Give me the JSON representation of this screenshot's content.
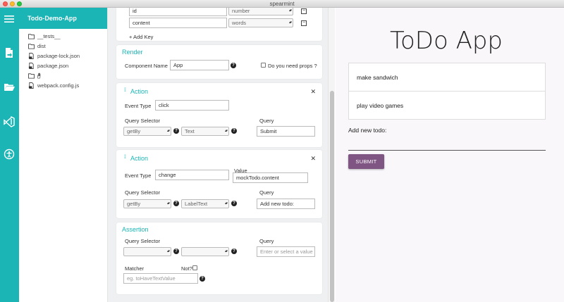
{
  "window": {
    "title": "spearmint"
  },
  "colors": {
    "accent": "#1bb5b5",
    "submit": "#7f5583"
  },
  "rail": {
    "icons": [
      "menu-icon",
      "export-file-icon",
      "folder-open-icon",
      "vscode-icon",
      "accessibility-icon"
    ]
  },
  "filetree": {
    "project": "Todo-Demo-App",
    "items": [
      {
        "name": "__tests__",
        "icon": "folder-icon"
      },
      {
        "name": "dist",
        "icon": "folder-icon"
      },
      {
        "name": "package-lock.json",
        "icon": "file-icon"
      },
      {
        "name": "package.json",
        "icon": "file-icon"
      },
      {
        "name": "",
        "icon": "folder-icon"
      },
      {
        "name": "webpack.config.js",
        "icon": "file-icon"
      }
    ]
  },
  "props_card": {
    "row1": {
      "key": "id",
      "type": "number"
    },
    "row2": {
      "key": "content",
      "type": "words"
    },
    "add_key": "+ Add Key"
  },
  "render": {
    "title": "Render",
    "component_name_label": "Component Name",
    "component_name_value": "App",
    "props_label": "Do you need props ?"
  },
  "action1": {
    "title": "Action",
    "event_type_label": "Event Type",
    "event_type_value": "click",
    "query_selector_label": "Query Selector",
    "selector1": "getBy",
    "selector2": "Text",
    "query_label": "Query",
    "query_value": "Submit"
  },
  "action2": {
    "title": "Action",
    "event_type_label": "Event Type",
    "event_type_value": "change",
    "value_label": "Value",
    "value_value": "mockTodo.content",
    "query_selector_label": "Query Selector",
    "selector1": "getBy",
    "selector2": "LabelText",
    "query_label": "Query",
    "query_value": "Add new todo:"
  },
  "assertion": {
    "title": "Assertion",
    "query_selector_label": "Query Selector",
    "query_label": "Query",
    "query_placeholder": "Enter or select a value",
    "matcher_label": "Matcher",
    "not_label": "Not?",
    "matcher_placeholder": "eg. toHaveTextValue"
  },
  "preview": {
    "title": "ToDo App",
    "todos": [
      "make sandwich",
      "play video games"
    ],
    "add_label": "Add new todo:",
    "submit_label": "SUBMIT"
  }
}
